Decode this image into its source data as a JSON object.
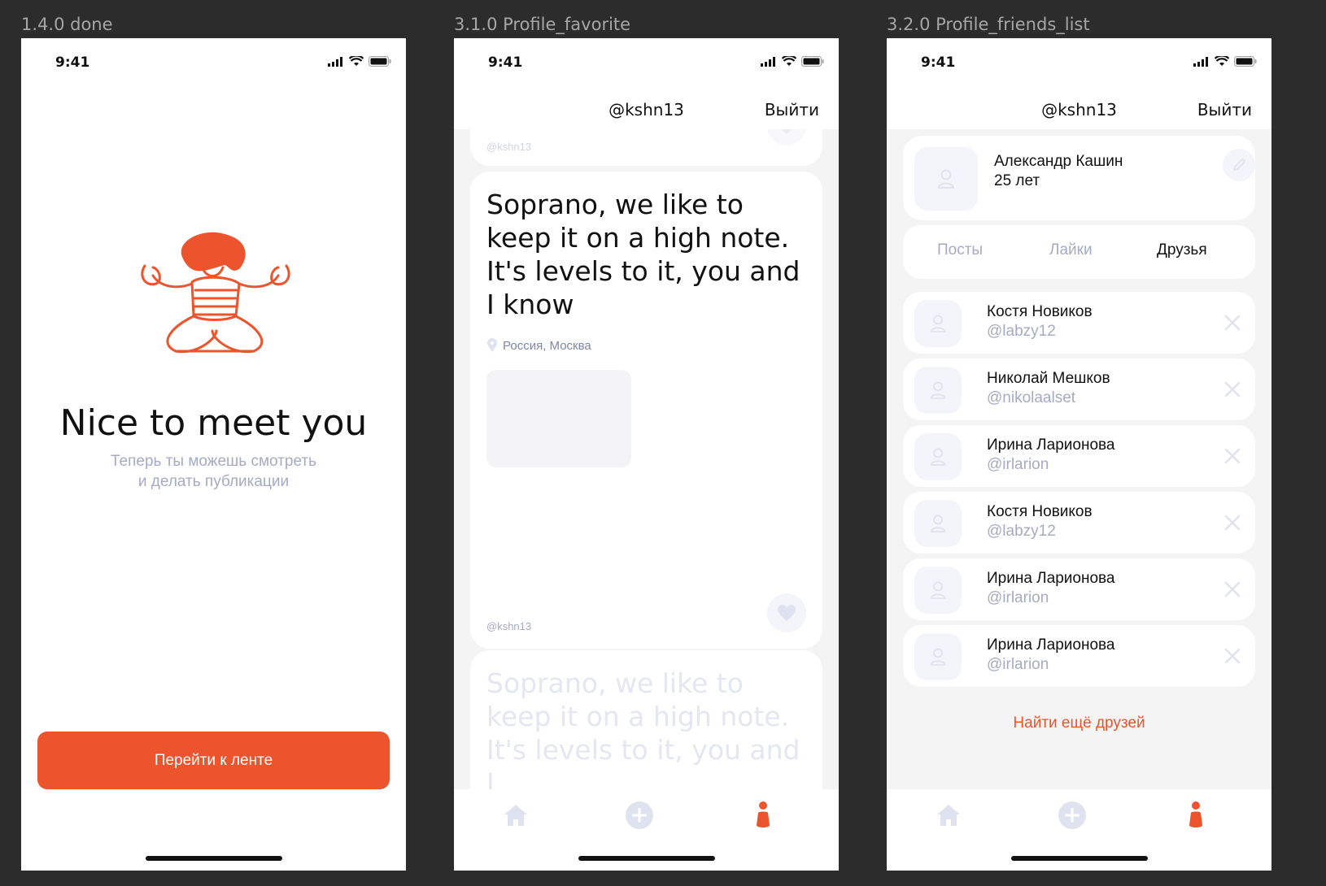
{
  "frames": [
    {
      "title": "1.4.0 done"
    },
    {
      "title": "3.1.0 Profile_favorite"
    },
    {
      "title": "3.2.0 Profile_friends_list"
    }
  ],
  "status_bar": {
    "time": "9:41"
  },
  "screen_done": {
    "title": "Nice to meet you",
    "subtitle_line1": "Теперь ты можешь смотреть",
    "subtitle_line2": "и делать публикации",
    "button_label": "Перейти к ленте"
  },
  "header": {
    "username": "@kshn13",
    "logout_label": "Выйти"
  },
  "feed": {
    "top_card_author": "@kshn13",
    "post": {
      "text": "Soprano, we like to keep it on a high note. It's levels to it, you and I know",
      "location": "Россия, Москва",
      "author": "@kshn13"
    },
    "faded_post_text": "Soprano, we like to keep it on a high note. It's levels to it, you and I"
  },
  "profile": {
    "name": "Александр Кашин",
    "age": "25 лет",
    "tabs": [
      "Посты",
      "Лайки",
      "Друзья"
    ],
    "active_tab": "Друзья",
    "friends": [
      {
        "name": "Костя Новиков",
        "handle": "@labzy12"
      },
      {
        "name": "Николай Мешков",
        "handle": "@nikolaalset"
      },
      {
        "name": "Ирина Ларионова",
        "handle": "@irlarion"
      },
      {
        "name": "Костя Новиков",
        "handle": "@labzy12"
      },
      {
        "name": "Ирина Ларионова",
        "handle": "@irlarion"
      },
      {
        "name": "Ирина Ларионова",
        "handle": "@irlarion"
      }
    ],
    "find_more_label": "Найти ещё друзей"
  },
  "colors": {
    "accent": "#eb542c",
    "muted": "#a5abc3",
    "background": "#2c2c2c",
    "card_bg": "#f4f4f4"
  },
  "icons": [
    "signal-icon",
    "wifi-icon",
    "battery-icon",
    "home-icon",
    "plus-circle-icon",
    "profile-icon",
    "heart-icon",
    "location-pin-icon",
    "avatar-placeholder-icon",
    "pencil-icon",
    "close-icon",
    "meditation-illustration"
  ]
}
